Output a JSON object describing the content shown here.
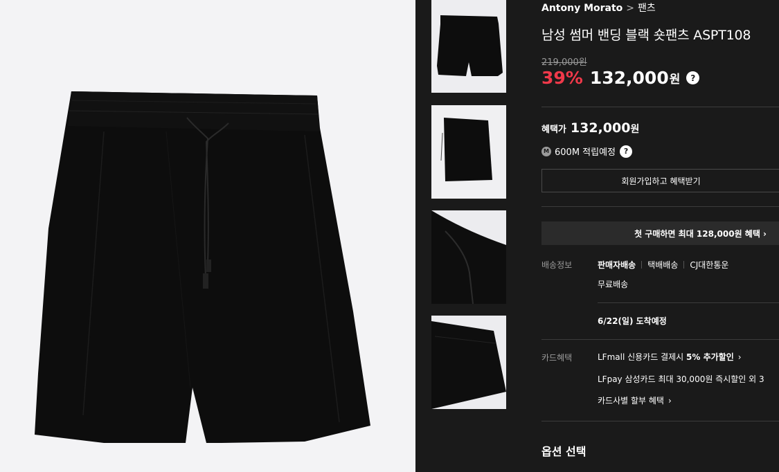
{
  "product": {
    "brand": "Antony Morato",
    "breadcrumb_separator": ">",
    "category": "팬츠",
    "title": "남성 썸머 밴딩 블랙 숏팬츠 ASPT108",
    "original_price": "219,000원",
    "discount": "39%",
    "sale_price": "132,000",
    "currency": "원",
    "help_icon": "?"
  },
  "benefit": {
    "label": "혜택가",
    "price": "132,000",
    "currency": "원",
    "mileage_badge": "M",
    "mileage_text": "600M 적립예정",
    "help_icon": "?",
    "join_button": "회원가입하고 혜택받기",
    "first_purchase": "첫 구매하면 최대 128,000원 혜택 ›"
  },
  "shipping": {
    "label": "배송정보",
    "seller": "판매자배송",
    "method": "택배배송",
    "courier": "CJ대한통운",
    "fee": "무료배송",
    "arrival": "6/22(일) 도착예정"
  },
  "card": {
    "label": "카드혜택",
    "line1_prefix": "LFmall 신용카드 결제시 ",
    "line1_bold": "5% 추가할인",
    "line1_chevron": "›",
    "line2": "LFpay 삼성카드 최대 30,000원 즉시할인 외 3",
    "line3": "카드사별 할부 혜택",
    "line3_chevron": "›"
  },
  "options": {
    "title": "옵션 선택"
  },
  "images": {
    "main": "black-shorts-front",
    "thumbnails": [
      "black-shorts-front",
      "black-shorts-side",
      "drawstring-detail",
      "waistband-detail"
    ]
  },
  "colors": {
    "background": "#1a1a1a",
    "discount": "#f0394a",
    "photo_background": "#f3f3f5",
    "garment": "#0d0d0d"
  }
}
